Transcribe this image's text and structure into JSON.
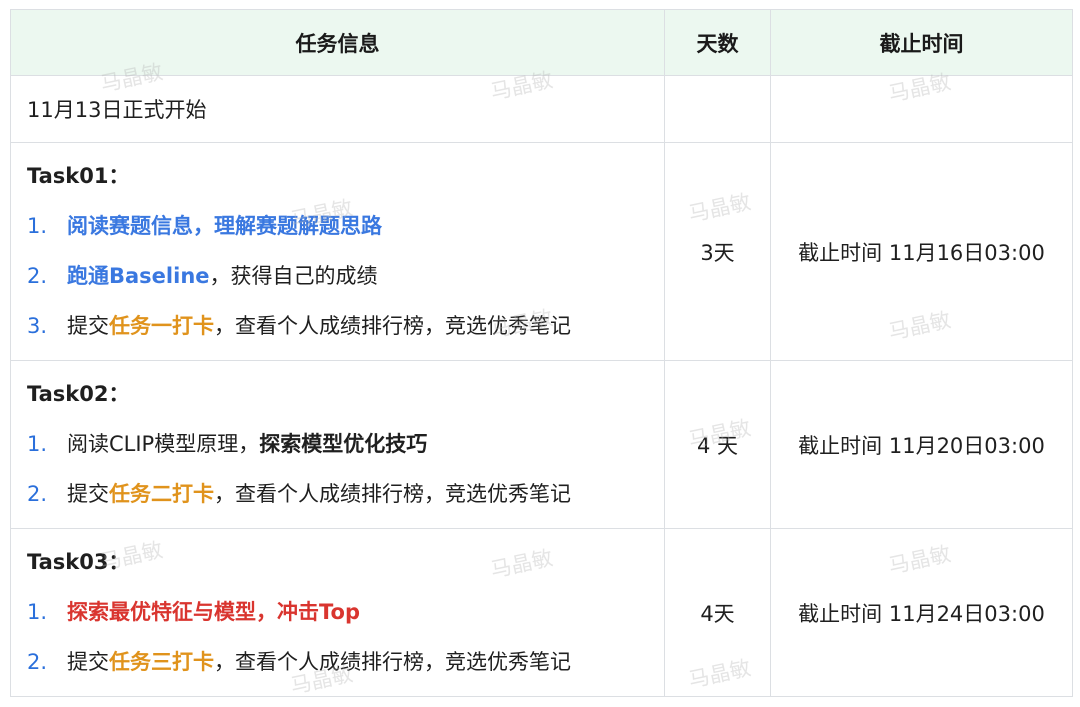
{
  "headers": {
    "info": "任务信息",
    "days": "天数",
    "deadline": "截止时间"
  },
  "start_row": {
    "info": "11月13日正式开始",
    "days": "",
    "deadline": ""
  },
  "task01": {
    "title": "Task01：",
    "items": [
      {
        "num": "1.",
        "t1": "",
        "h1": "阅读赛题信息，理解赛题解题思路",
        "t2": ""
      },
      {
        "num": "2.",
        "t1": "",
        "h1": "跑通Baseline",
        "t2": "，获得自己的成绩"
      },
      {
        "num": "3.",
        "t1": "提交",
        "h1": "任务一打卡",
        "t2": "，查看个人成绩排行榜，竞选优秀笔记"
      }
    ],
    "days": "3天",
    "deadline": "截止时间 11月16日03:00"
  },
  "task02": {
    "title": "Task02：",
    "items": [
      {
        "num": "1.",
        "t1": "阅读CLIP模型原理，",
        "h1": "探索模型优化技巧",
        "t2": ""
      },
      {
        "num": "2.",
        "t1": "提交",
        "h1": "任务二打卡",
        "t2": "，查看个人成绩排行榜，竞选优秀笔记"
      }
    ],
    "days": "4 天",
    "deadline": "截止时间 11月20日03:00"
  },
  "task03": {
    "title": "Task03：",
    "items": [
      {
        "num": "1.",
        "t1": "",
        "h1": "探索最优特征与模型，冲击Top",
        "t2": ""
      },
      {
        "num": "2.",
        "t1": "提交",
        "h1": "任务三打卡",
        "t2": "，查看个人成绩排行榜，竞选优秀笔记"
      }
    ],
    "days": "4天",
    "deadline": "截止时间 11月24日03:00"
  },
  "watermark": "马晶敏",
  "colors": {
    "header_bg": "#ecf8f0",
    "blue": "#3a78e0",
    "orange": "#e0931c",
    "red": "#d9352f",
    "number": "#2a6fdb"
  }
}
